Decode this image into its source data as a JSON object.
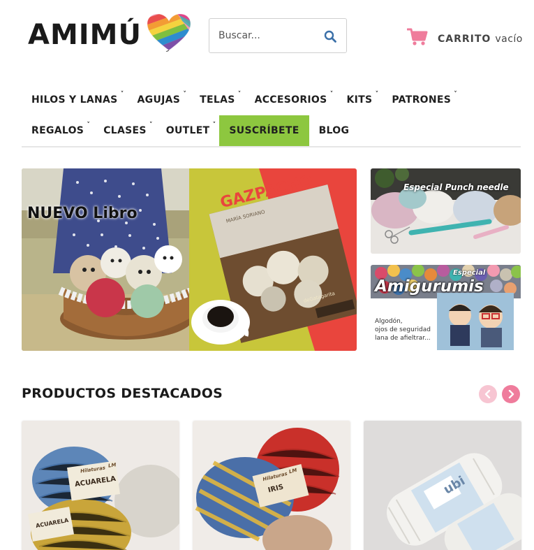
{
  "header": {
    "logo_text": "AMIMÚ",
    "search_placeholder": "Buscar...",
    "cart_label": "CARRITO",
    "cart_status": "vacío"
  },
  "nav": {
    "row1": [
      {
        "label": "HILOS Y LANAS",
        "dropdown": true
      },
      {
        "label": "AGUJAS",
        "dropdown": true
      },
      {
        "label": "TELAS",
        "dropdown": true
      },
      {
        "label": "ACCESORIOS",
        "dropdown": true
      },
      {
        "label": "KITS",
        "dropdown": true
      },
      {
        "label": "PATRONES",
        "dropdown": true
      }
    ],
    "row2": [
      {
        "label": "REGALOS",
        "dropdown": true
      },
      {
        "label": "CLASES",
        "dropdown": true
      },
      {
        "label": "OUTLET",
        "dropdown": true
      },
      {
        "label": "SUSCRÍBETE",
        "dropdown": false
      },
      {
        "label": "BLOG",
        "dropdown": false
      }
    ]
  },
  "banners": {
    "main": {
      "headline": "NUEVO Libro",
      "book_title": "GAZPACHO",
      "book_author": "MARÍA SORIANO",
      "book_publisher": "deGatagarita"
    },
    "side1": {
      "title": "Especial Punch needle"
    },
    "side2": {
      "kicker": "Especial",
      "title": "Amigurumis",
      "line1": "Algodón,",
      "line2": "ojos de seguridad",
      "line3": "lana de afieltrar..."
    }
  },
  "featured": {
    "title": "PRODUCTOS DESTACADOS",
    "products": [
      {
        "brand_line1": "Hilaturas",
        "brand_line2": "LM",
        "name": "ACUARELA"
      },
      {
        "brand_line1": "Hilaturas",
        "brand_line2": "LM",
        "name": "IRIS"
      },
      {
        "brand_line1": "",
        "brand_line2": "",
        "name": "ubi"
      }
    ]
  },
  "colors": {
    "accent_green": "#8dc73f",
    "cart_pink": "#ef7c9c",
    "arrow_prev": "#f7c5d2",
    "arrow_next": "#ef7c9c",
    "search_icon": "#3a6fa8"
  }
}
